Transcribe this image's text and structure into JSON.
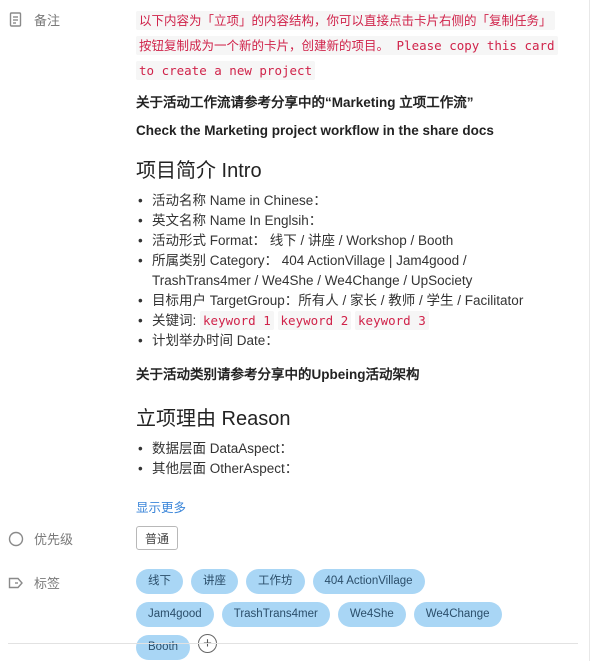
{
  "note": {
    "label": "备注",
    "code_lines": [
      "以下内容为「立项」的内容结构，你可以直接点击卡片右侧的「复制任务」",
      "按钮复制成为一个新的卡片，创建新的项目。 Please copy this card",
      "to create a new project"
    ],
    "workflow_cn": "关于活动工作流请参考分享中的“Marketing 立项工作流”",
    "workflow_en": "Check the Marketing project workflow in the share docs",
    "intro": {
      "heading": "项目简介 Intro",
      "items": [
        "活动名称 Name in Chinese：",
        "英文名称 Name In Englsih：",
        "活动形式 Format： 线下 / 讲座 / Workshop / Booth",
        "所属类别 Category： 404 ActionVillage | Jam4good /",
        "TrashTrans4mer / We4She / We4Change / UpSociety",
        "目标用户 TargetGroup：所有人 / 家长 / 教师 / 学生 / Facilitator"
      ],
      "keywords_label": "关键词:",
      "keywords": [
        "keyword 1",
        "keyword 2",
        "keyword 3"
      ],
      "date_item": "计划举办时间 Date："
    },
    "category_ref": "关于活动类别请参考分享中的Upbeing活动架构",
    "reason": {
      "heading": "立项理由 Reason",
      "items": [
        "数据层面 DataAspect：",
        "其他层面 OtherAspect："
      ]
    },
    "show_more": "显示更多"
  },
  "priority": {
    "label": "优先级",
    "value": "普通"
  },
  "tags": {
    "label": "标签",
    "items": [
      "线下",
      "讲座",
      "工作坊",
      "404 ActionVillage",
      "Jam4good",
      "TrashTrans4mer",
      "We4She",
      "We4Change",
      "Booth"
    ],
    "add_icon": "plus-circle-icon"
  },
  "colors": {
    "tag_bg": "#a9d6f5",
    "code_text": "#d0234a",
    "link": "#3b86d9"
  }
}
